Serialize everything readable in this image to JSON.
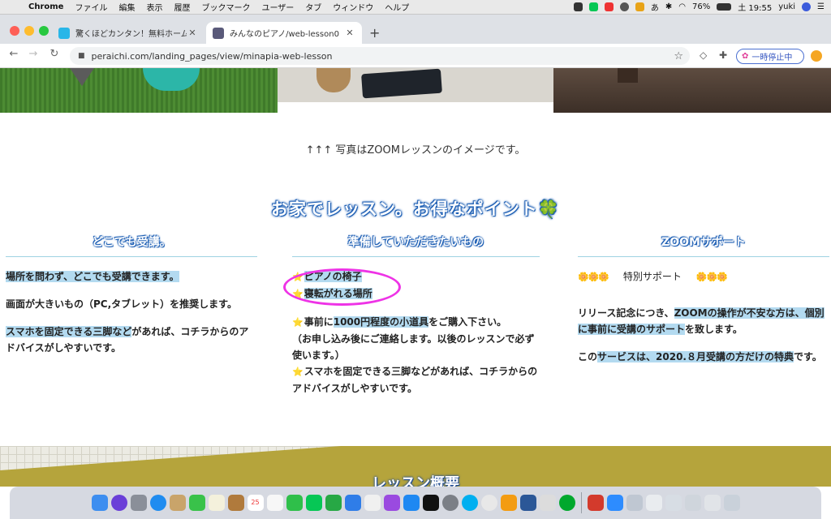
{
  "menubar": {
    "app_name": "Chrome",
    "items": [
      "ファイル",
      "編集",
      "表示",
      "履歴",
      "ブックマーク",
      "ユーザー",
      "タブ",
      "ウィンドウ",
      "ヘルプ"
    ],
    "battery": "76%",
    "ime": "あ",
    "clock": "土 19:55",
    "user": "yuki"
  },
  "tabs": [
    {
      "title": "驚くほどカンタン！無料ホームペ",
      "favicon_color": "#29b6e8",
      "active": false
    },
    {
      "title": "みんなのピアノ/web-lesson0",
      "favicon_color": "#5a5a7a",
      "active": true
    }
  ],
  "toolbar": {
    "url": "peraichi.com/landing_pages/view/minapia-web-lesson",
    "pause_label": "一時停止中"
  },
  "page": {
    "caption": "↑↑↑ 写真はZOOMレッスンのイメージです。",
    "section_title": "お家でレッスン。お得なポイント🍀",
    "columns": [
      {
        "title": "どこでも受講。",
        "paragraphs": [
          {
            "pre": "",
            "highlight": "場所を問わず、どこでも受講できます。",
            "post": ""
          },
          {
            "pre": "画面が大きいもの（PC,タブレット）を推奨します。",
            "highlight": "",
            "post": ""
          },
          {
            "pre": "",
            "highlight": "スマホを固定できる三脚など",
            "post": "があれば、コチラからのアドバイスがしやすいです。"
          }
        ]
      },
      {
        "title": "準備していただきたいもの",
        "items": [
          {
            "icon": "⭐",
            "text": "ピアノの椅子"
          },
          {
            "icon": "⭐",
            "text": "寝転がれる場所"
          }
        ],
        "paragraphs": [
          {
            "icon": "⭐",
            "pre": "事前に",
            "highlight": "1000円程度の小道具",
            "post": "をご購入下さい。\n（お申し込み後にご連絡します。以後のレッスンで必ず使います。）"
          },
          {
            "icon": "⭐",
            "pre": "スマホを固定できる三脚などがあれば、コチラからのアドバイスがしやすいです。",
            "highlight": "",
            "post": ""
          }
        ]
      },
      {
        "title": "ZOOMサポート",
        "special": {
          "flowers": "🌼🌼🌼",
          "label": "特別サポート"
        },
        "paragraphs": [
          {
            "pre": "リリース記念につき、",
            "highlight": "ZOOMの操作が不安な方は、個別に事前に受講のサポート",
            "post": "を致します。"
          },
          {
            "pre": "この",
            "highlight": "サービスは、2020.８月受講の方だけの特典",
            "post": "です。"
          }
        ]
      }
    ],
    "next_section_title": "レッスン概要"
  },
  "colors": {
    "heading_outline": "#1e5fb4",
    "highlight": "#b3daf0",
    "annotation_circle": "#ee33e6",
    "olive_band": "#b5a43c"
  },
  "dock": {
    "apps": [
      "finder",
      "siri",
      "launchpad",
      "safari",
      "contacts",
      "messages",
      "notes",
      "notebook",
      "calendar",
      "photos",
      "facetime",
      "line",
      "numbers",
      "keynote",
      "music",
      "podcasts",
      "app-store",
      "tv",
      "system-preferences",
      "skype",
      "chrome",
      "books",
      "word",
      "alpa",
      "evernote",
      "ui-browser",
      "dictionary",
      "zoom"
    ],
    "calendar_day": "25"
  }
}
